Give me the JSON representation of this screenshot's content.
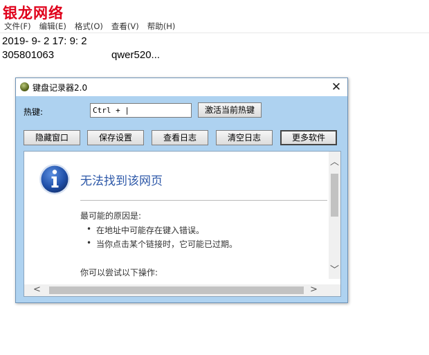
{
  "watermark": "银龙网络",
  "notepad": {
    "menu": [
      "文件(F)",
      "编辑(E)",
      "格式(O)",
      "查看(V)",
      "帮助(H)"
    ],
    "lines": [
      "2019- 9- 2 17: 9: 2",
      "305801063",
      "qwer520..."
    ]
  },
  "dialog": {
    "title": "键盘记录器2.0",
    "close_glyph": "✕",
    "hotkey_label": "热键:",
    "hotkey_value": "Ctrl + |",
    "activate_button": "激活当前热键",
    "buttons": [
      "隐藏窗口",
      "保存设置",
      "查看日志",
      "清空日志",
      "更多软件"
    ]
  },
  "browser": {
    "error_title": "无法找到该网页",
    "reason_heading": "最可能的原因是:",
    "reasons": [
      "在地址中可能存在键入错误。",
      "当你点击某个链接时，它可能已过期。"
    ],
    "try_heading": "你可以尝试以下操作:"
  },
  "icons": {
    "app": "keyboard-logger-icon",
    "info": "info-icon",
    "close": "close-icon"
  },
  "colors": {
    "watermark": "#e0001b",
    "dialog_bg": "#aed2f0",
    "error_title": "#2d58a8",
    "info_blue": "#1f4fa8"
  }
}
